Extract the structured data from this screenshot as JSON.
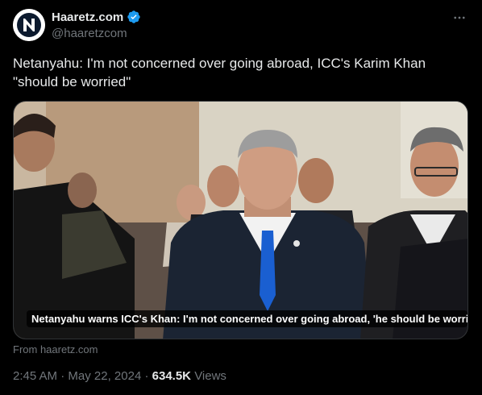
{
  "author": {
    "display_name": "Haaretz.com",
    "handle": "@haaretzcom",
    "avatar_icon": "haaretz-logo-icon",
    "verified_icon": "verified-badge-icon",
    "verified_color": "#1d9bf0"
  },
  "more_icon": "more-options-icon",
  "tweet": {
    "text": "Netanyahu: I'm not concerned over going abroad, ICC's Karim Khan \"should be worried\""
  },
  "card": {
    "caption": "Netanyahu warns ICC's Khan: I'm not concerned over going abroad, 'he should be worrie...",
    "source": "From haaretz.com"
  },
  "meta": {
    "time": "2:45 AM",
    "separator": "·",
    "date": "May 22, 2024",
    "views_count": "634.5K",
    "views_label": "Views"
  },
  "colors": {
    "background": "#000000",
    "text": "#e7e9ea",
    "secondary": "#71767b",
    "border": "#2f3336"
  }
}
